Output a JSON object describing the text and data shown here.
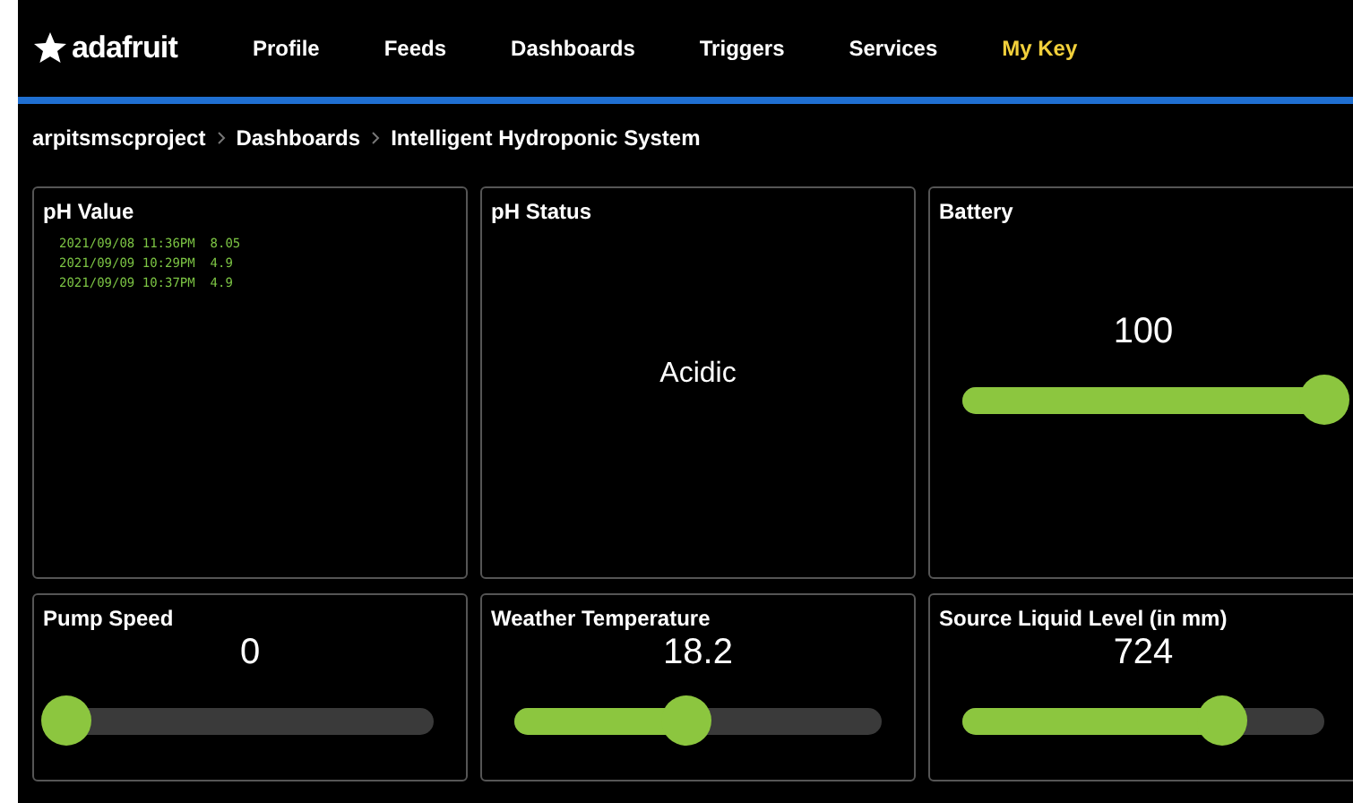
{
  "nav": {
    "logo": "adafruit",
    "items": [
      {
        "label": "Profile",
        "selected": false
      },
      {
        "label": "Feeds",
        "selected": false
      },
      {
        "label": "Dashboards",
        "selected": false
      },
      {
        "label": "Triggers",
        "selected": false
      },
      {
        "label": "Services",
        "selected": false
      },
      {
        "label": "My Key",
        "selected": true
      }
    ]
  },
  "breadcrumb": [
    "arpitsmscproject",
    "Dashboards",
    "Intelligent Hydroponic System"
  ],
  "blocks": [
    {
      "kind": "log",
      "title": "pH Value",
      "lines": [
        "2021/09/08 11:36PM  8.05",
        "2021/09/09 10:29PM  4.9",
        "2021/09/09 10:37PM  4.9"
      ]
    },
    {
      "kind": "text",
      "title": "pH Status",
      "value": "Acidic"
    },
    {
      "kind": "slider",
      "title": "Battery",
      "value": "100",
      "level": 1
    },
    {
      "kind": "slider",
      "title": "Pump Speed",
      "value": "0",
      "level": 0
    },
    {
      "kind": "slider",
      "title": "Weather Temperature",
      "value": "18.2",
      "level": 0.47
    },
    {
      "kind": "slider",
      "title": "Source Liquid Level (in mm)",
      "value": "724",
      "level": 0.72
    }
  ]
}
